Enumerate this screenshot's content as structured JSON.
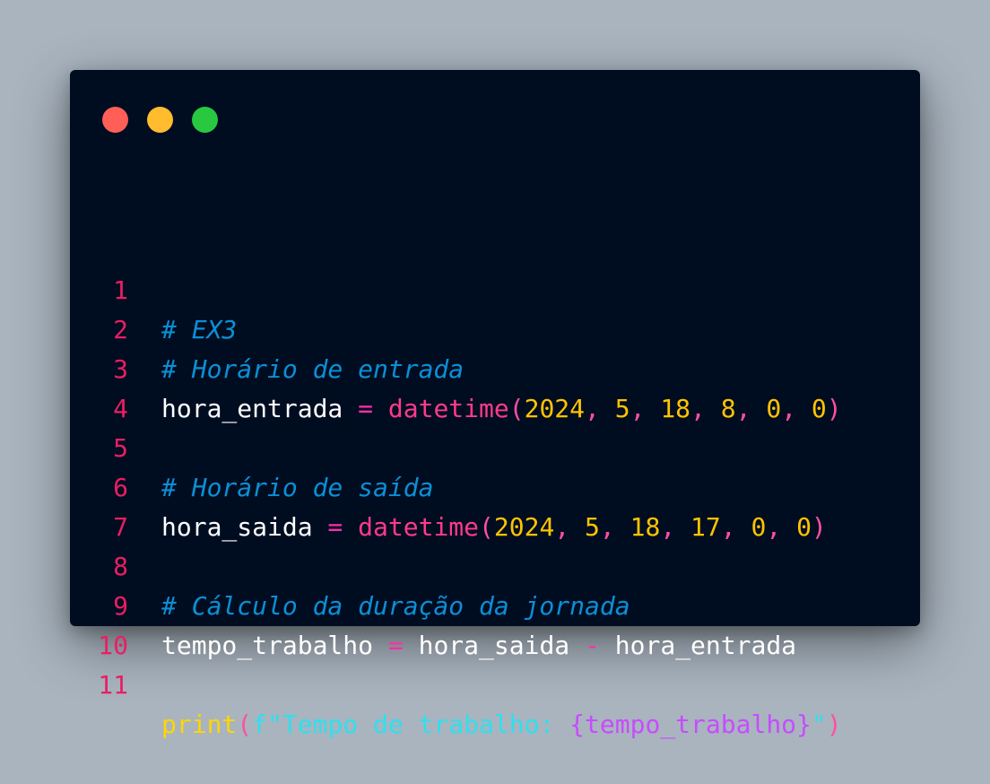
{
  "window": {
    "controls": [
      "close",
      "minimize",
      "maximize"
    ],
    "colors": {
      "background": "#000d21",
      "close": "#ff5f57",
      "minimize": "#febc2e",
      "maximize": "#28c840"
    }
  },
  "code": {
    "line_numbers": [
      "1",
      "2",
      "3",
      "4",
      "5",
      "6",
      "7",
      "8",
      "9",
      "10",
      "11"
    ],
    "line1": {
      "comment": "# EX3"
    },
    "line2": {
      "comment": "# Horário de entrada"
    },
    "line3": {
      "var": "hora_entrada",
      "op": " = ",
      "fn": "datetime",
      "open": "(",
      "a1": "2024",
      "s1": ", ",
      "a2": "5",
      "s2": ", ",
      "a3": "18",
      "s3": ", ",
      "a4": "8",
      "s4": ", ",
      "a5": "0",
      "s5": ", ",
      "a6": "0",
      "close": ")"
    },
    "line5": {
      "comment": "# Horário de saída"
    },
    "line6": {
      "var": "hora_saida",
      "op": " = ",
      "fn": "datetime",
      "open": "(",
      "a1": "2024",
      "s1": ", ",
      "a2": "5",
      "s2": ", ",
      "a3": "18",
      "s3": ", ",
      "a4": "17",
      "s4": ", ",
      "a5": "0",
      "s5": ", ",
      "a6": "0",
      "close": ")"
    },
    "line8": {
      "comment": "# Cálculo da duração da jornada"
    },
    "line9": {
      "var": "tempo_trabalho",
      "op1": " = ",
      "lhs": "hora_saida",
      "op2": " - ",
      "rhs": "hora_entrada"
    },
    "line11": {
      "fn": "print",
      "open": "(",
      "str_start": "f\"Tempo de trabalho: ",
      "brace_open": "{",
      "ivar": "tempo_trabalho",
      "brace_close": "}",
      "str_end": "\"",
      "close": ")"
    }
  }
}
